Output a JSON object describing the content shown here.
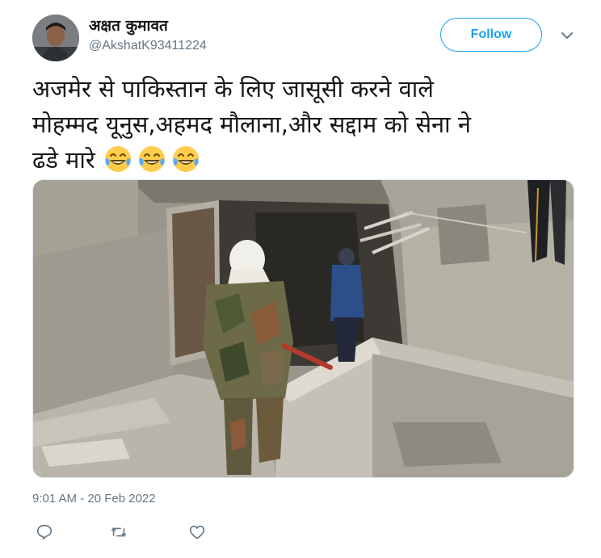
{
  "tweet": {
    "author_name": "अक्षत कुमावत",
    "author_handle": "@AkshatK93411224",
    "follow_label": "Follow",
    "text_line1": "अजमेर से पाकिस्तान के लिए जासूसी करने वाले",
    "text_line2": "मोहम्मद यूनुस,अहमद मौलाना,और सद्दाम को सेना ने",
    "text_line3": "ढडे मारे",
    "emoji_count": 3,
    "timestamp": "9:01 AM - 20 Feb 2022"
  },
  "icons": {
    "avatar": "avatar",
    "more": "chevron-down-icon",
    "emoji": "laughing-tears-emoji",
    "reply": "reply-icon",
    "retweet": "retweet-icon",
    "like": "heart-icon"
  },
  "colors": {
    "accent": "#1da1f2",
    "secondary_text": "#657786",
    "icon": "#657786"
  }
}
